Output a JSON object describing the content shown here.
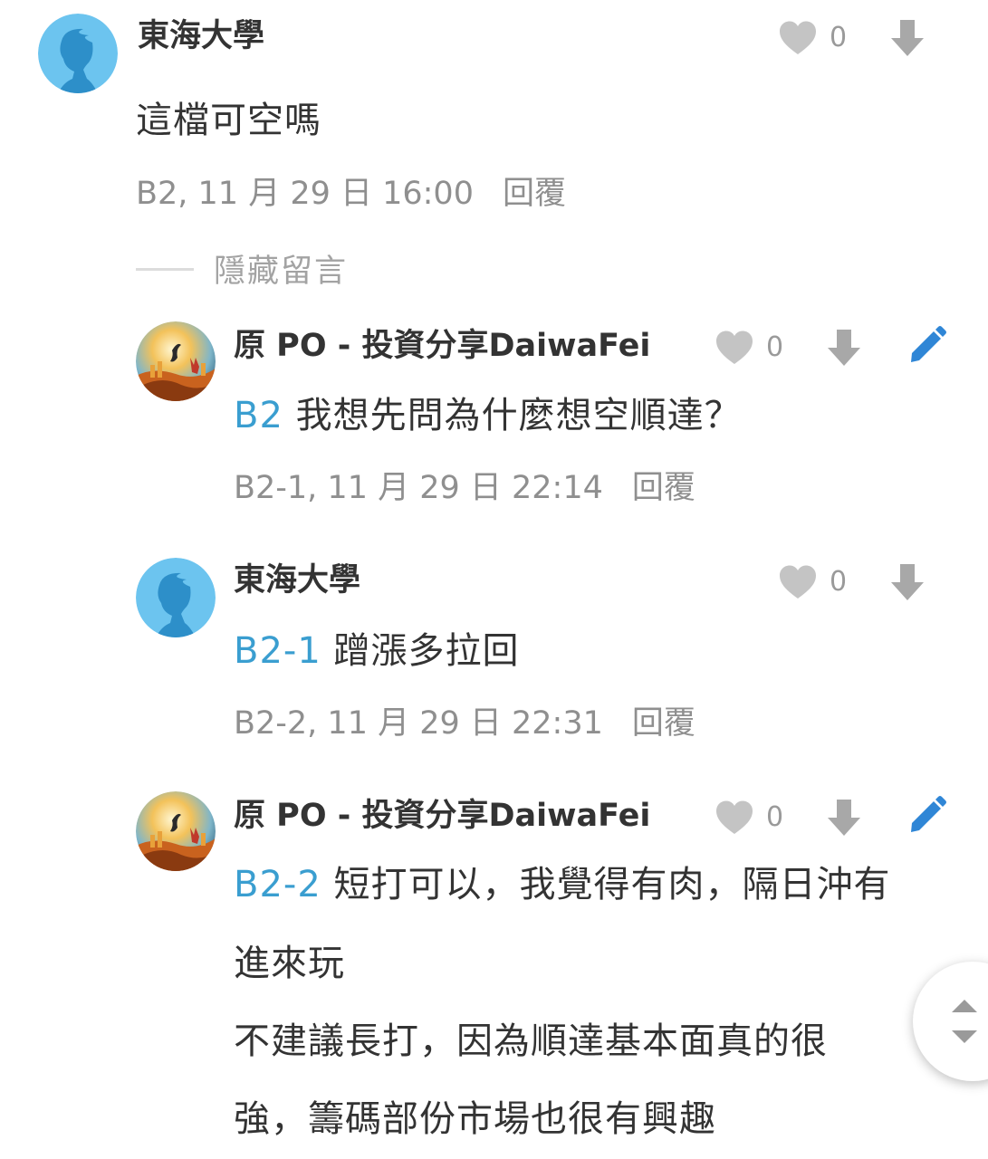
{
  "comments": [
    {
      "author": "東海大學",
      "body_tag": "",
      "body": "這檔可空嗎",
      "meta": "B2, 11 月 29 日 16:00",
      "reply_label": "回覆",
      "likes": "0",
      "avatar": "default-person-icon"
    },
    {
      "author": "原 PO - 投資分享DaiwaFei",
      "body_tag": "B2",
      "body": "我想先問為什麼想空順達？",
      "meta": "B2-1, 11 月 29 日 22:14",
      "reply_label": "回覆",
      "likes": "0",
      "avatar": "illustrated-avatar"
    },
    {
      "author": "東海大學",
      "body_tag": "B2-1",
      "body": "蹭漲多拉回",
      "meta": "B2-2, 11 月 29 日 22:31",
      "reply_label": "回覆",
      "likes": "0",
      "avatar": "default-person-icon"
    },
    {
      "author": "原 PO - 投資分享DaiwaFei",
      "body_tag": "B2-2",
      "body_lines": [
        "短打可以，我覺得有肉，隔日沖有",
        "進來玩",
        "不建議長打，因為順達基本面真的很",
        "強，籌碼部份市場也很有興趣"
      ],
      "likes": "0",
      "avatar": "illustrated-avatar"
    }
  ],
  "hide_replies_label": "隱藏留言",
  "colors": {
    "tag_blue": "#3a9ed0",
    "avatar_blue": "#6cc4ef",
    "icon_gray": "#c4c4c4",
    "edit_blue": "#2f86d6"
  },
  "icons": [
    "heart-icon",
    "downvote-arrow-icon",
    "edit-pencil-icon",
    "scroll-up-down-icon"
  ]
}
